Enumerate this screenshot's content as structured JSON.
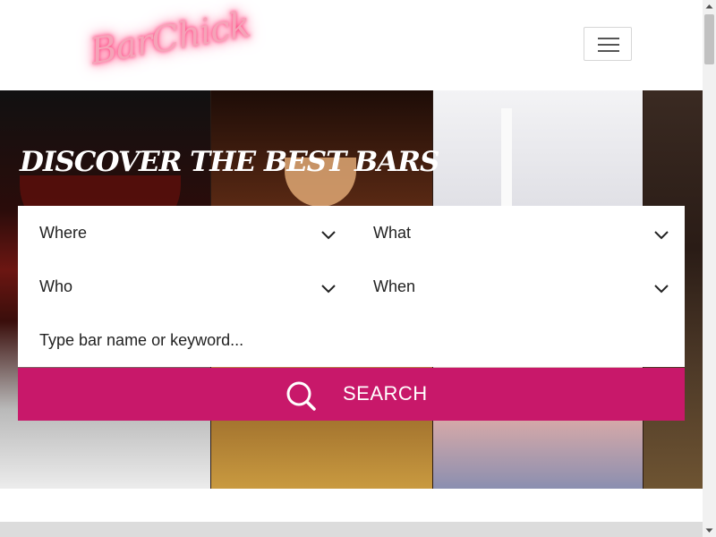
{
  "header": {
    "logo_text": "BarChick",
    "menu_button_label": "Toggle navigation"
  },
  "hero": {
    "title": "DISCOVER THE BEST BARS"
  },
  "search_form": {
    "where_label": "Where",
    "what_label": "What",
    "who_label": "Who",
    "when_label": "When",
    "keyword_placeholder": "Type bar name or keyword...",
    "keyword_value": "",
    "search_button_label": "SEARCH"
  },
  "colors": {
    "accent": "#c8186a",
    "logo_neon": "#ff4d85"
  },
  "icons": {
    "dropdown": "chevron-down-icon",
    "search": "search-icon",
    "menu": "hamburger-icon"
  }
}
